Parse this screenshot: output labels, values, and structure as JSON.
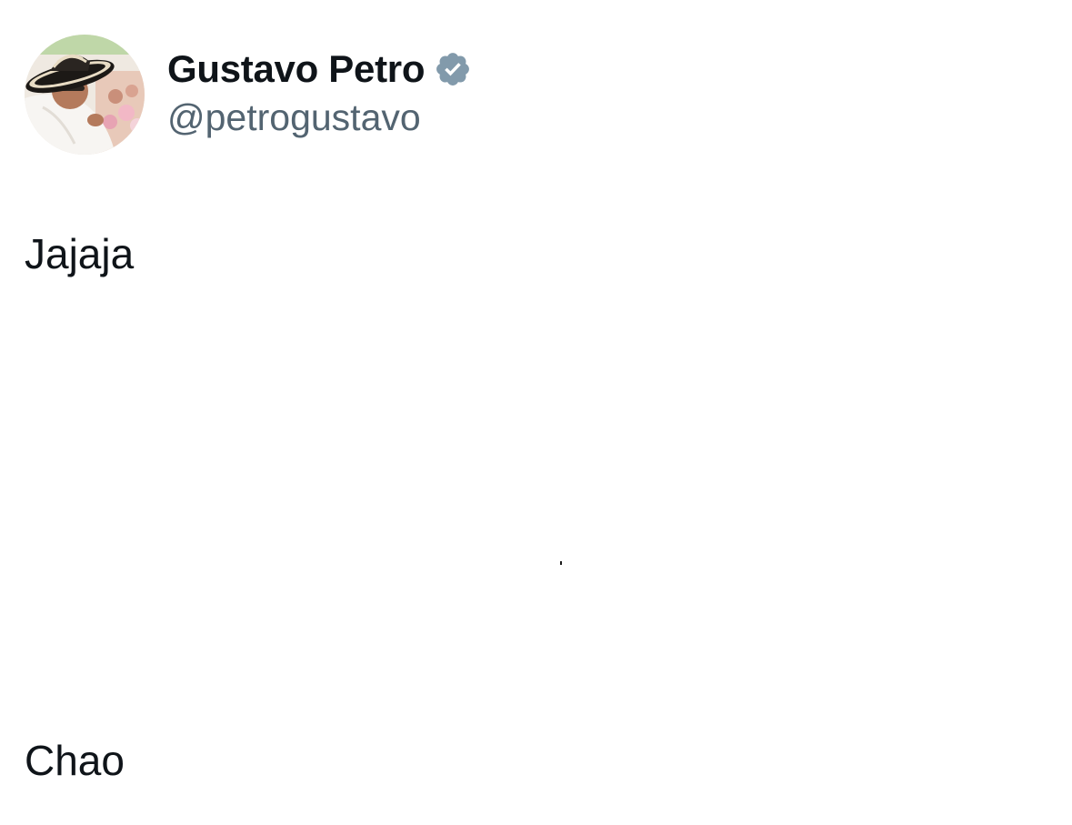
{
  "author": {
    "display_name": "Gustavo Petro",
    "handle": "@petrogustavo",
    "verified": true,
    "avatar_icon": "profile-photo-sombrero-vueltiao",
    "verified_badge_color": "#829aab"
  },
  "tweet": {
    "lines": [
      "Jajaja",
      "Chao"
    ]
  },
  "colors": {
    "text_primary": "#0f1419",
    "text_secondary": "#536471",
    "background": "#ffffff"
  }
}
